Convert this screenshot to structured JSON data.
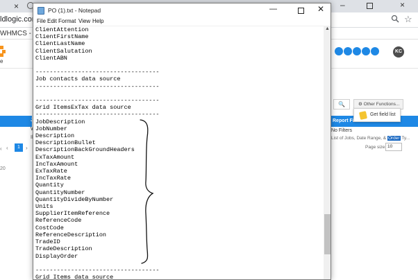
{
  "browser": {
    "tab_close": "×",
    "url_text": "ldlogic.com.a",
    "bookmark_text": "WHMCS - Login",
    "zoom_icon": "zoom-icon",
    "star_icon": "star-icon",
    "win_min": "–",
    "win_close": "×"
  },
  "background_app": {
    "logo_text": "e",
    "avatar_initials": "KC",
    "search_glyph": "🔍",
    "other_functions_label": "⚙ Other Functions...  ⌄",
    "dropdown_item": "Get field list",
    "report_filter_title": "Report Filter",
    "left_header_fragment": "Jo",
    "left_row1": "W",
    "left_row2": "Ill",
    "no_filters": "No Filters",
    "filter_list_prefix": "List of Jobs, Date Range, & ",
    "filter_list_highlight": "Order",
    "filter_list_suffix": " Ty...",
    "page_size_label": "Page size:",
    "page_size_value": "10",
    "pager_prev": "‹",
    "pager_current": "1",
    "pager_next": "›",
    "count_fragment": "20",
    "accent_color": "#1e88e5",
    "logo_color": "#f7941d"
  },
  "notepad": {
    "title": "PO (1).txt - Notepad",
    "menu": [
      "File",
      "Edit",
      "Format",
      "View",
      "Help"
    ],
    "lines": [
      "ClientAttention",
      "ClientFirstName",
      "ClientLastName",
      "ClientSalutation",
      "ClientABN",
      "",
      "-----------------------------------",
      "Job contacts data source",
      "-----------------------------------",
      "",
      "-----------------------------------",
      "Grid ItemsExTax data source",
      "-----------------------------------",
      "JobDescription",
      "JobNumber",
      "Description",
      "DescriptionBullet",
      "DescriptionBackGroundHeaders",
      "ExTaxAmount",
      "IncTaxAmount",
      "ExTaxRate",
      "IncTaxRate",
      "Quantity",
      "QuantityNumber",
      "QuantityDivideByNumber",
      "Units",
      "SupplierItemReference",
      "ReferenceCode",
      "CostCode",
      "ReferenceDescription",
      "TradeID",
      "TradeDescription",
      "DisplayOrder",
      "",
      "-----------------------------------",
      "Grid Items data source"
    ]
  }
}
